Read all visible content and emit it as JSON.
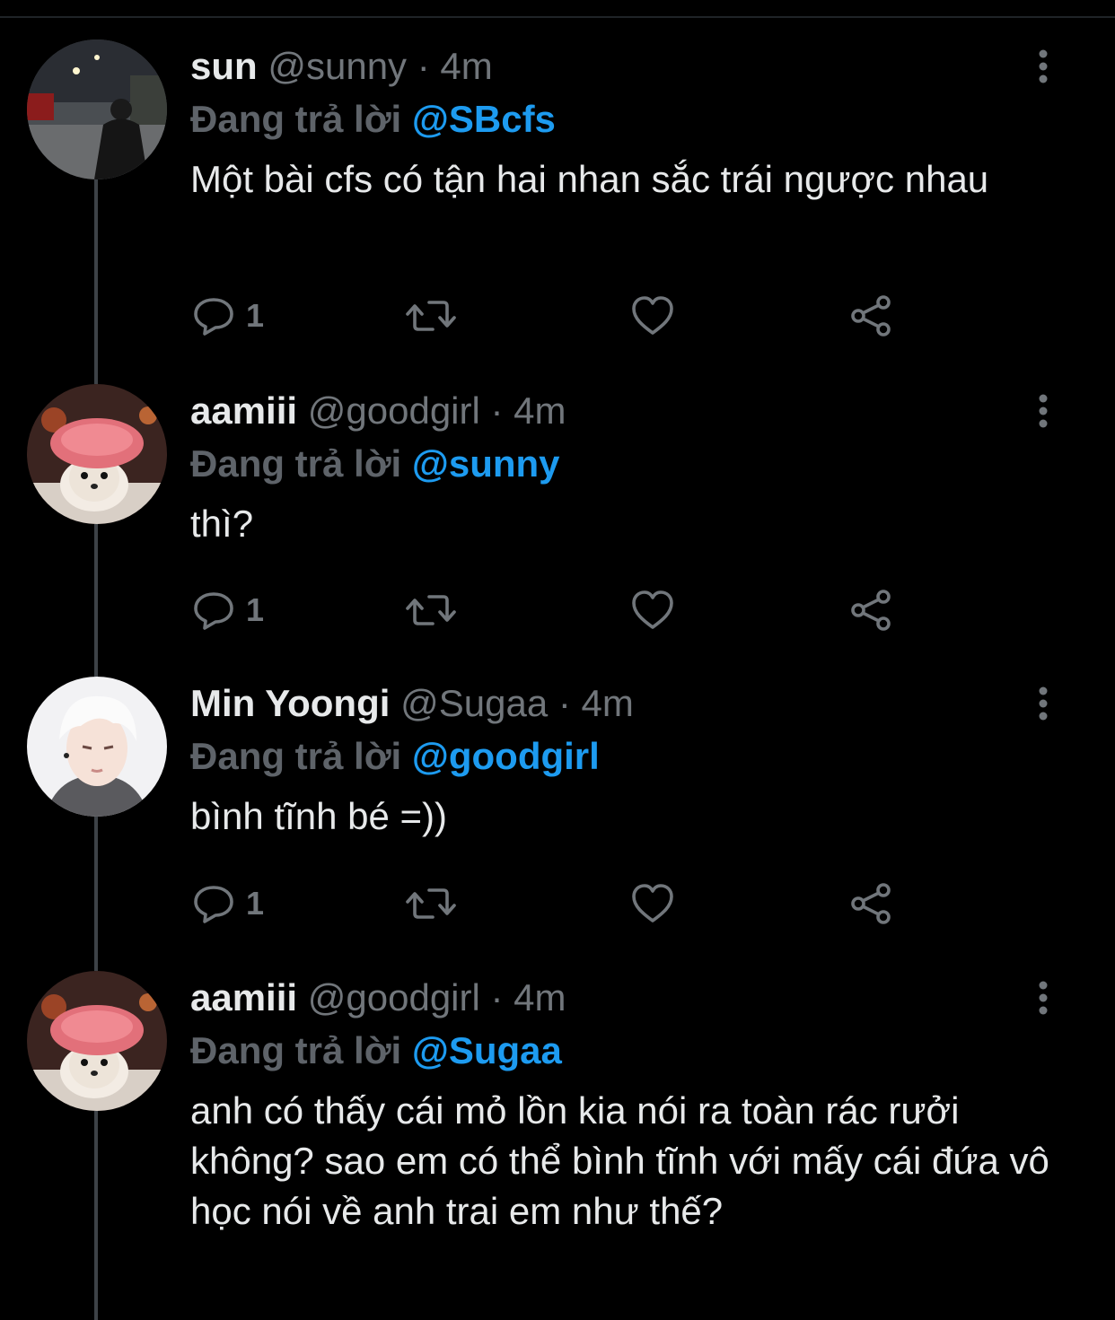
{
  "colors": {
    "background": "#000000",
    "text": "#e7e9ea",
    "muted": "#71767b",
    "mention": "#1d9bf0",
    "thread_line": "#3d4247"
  },
  "icons": {
    "reply": "speech-bubble-icon",
    "retweet": "retweet-arrows-icon",
    "like": "heart-outline-icon",
    "share": "share-nodes-icon",
    "more": "vertical-ellipsis-icon"
  },
  "tweets": [
    {
      "name": "sun",
      "handle": "@sunny",
      "separator": "·",
      "time": "4m",
      "reply_prefix": "Đang trả lời",
      "reply_to": "@SBcfs",
      "text": "Một bài cfs có tận hai nhan sắc trái ngược nhau",
      "reply_count": "1"
    },
    {
      "name": "aamiii",
      "handle": "@goodgirl",
      "separator": "·",
      "time": "4m",
      "reply_prefix": "Đang trả lời",
      "reply_to": "@sunny",
      "text": "thì?",
      "reply_count": "1"
    },
    {
      "name": "Min Yoongi",
      "handle": "@Sugaa",
      "separator": "·",
      "time": "4m",
      "reply_prefix": "Đang trả lời",
      "reply_to": "@goodgirl",
      "text": "bình tĩnh bé =))",
      "reply_count": "1"
    },
    {
      "name": "aamiii",
      "handle": "@goodgirl",
      "separator": "·",
      "time": "4m",
      "reply_prefix": "Đang trả lời",
      "reply_to": "@Sugaa",
      "text": "anh có thấy cái mỏ lồn kia nói ra toàn rác rưởi không? sao em có thể bình tĩnh với mấy cái đứa vô học nói về anh trai em như thế?"
    }
  ]
}
